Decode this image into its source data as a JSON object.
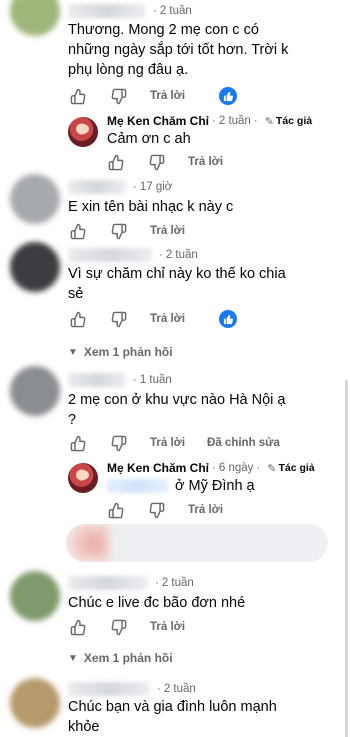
{
  "comments": [
    {
      "time": "2 tuần",
      "text_lines": [
        "Thương. Mong 2 mẹ con c có",
        "những ngày sắp tới tốt hơn. Trời k",
        "phụ lòng ng đâu ạ."
      ],
      "reply_label": "Trả lời",
      "reaction": "like",
      "avatar_color": "#9fb57a"
    },
    {
      "author": "Mẹ Ken Chăm Chỉ",
      "time": "2 tuần",
      "badge": "Tác giả",
      "text_lines": [
        "Cảm ơn c ah"
      ],
      "reply_label": "Trả lời"
    },
    {
      "time": "17 giờ",
      "text_lines": [
        "E xin tên bài nhạc k này c"
      ],
      "reply_label": "Trả lời",
      "avatar_color": "#a6a9ad"
    },
    {
      "time": "2 tuần",
      "text_lines": [
        "Vì sự chăm chỉ này ko thế ko chia",
        "sẻ"
      ],
      "reply_label": "Trả lời",
      "reaction": "like",
      "view_replies": "Xem 1 phản hồi",
      "avatar_color": "#3b3d40"
    },
    {
      "time": "1 tuần",
      "text_lines": [
        "2 mẹ con ở khu vực nào Hà Nội ạ",
        "?"
      ],
      "reply_label": "Trả lời",
      "edited": "Đã chỉnh sửa",
      "avatar_color": "#8a8d91"
    },
    {
      "author": "Mẹ Ken Chăm Chỉ",
      "time": "6 ngày",
      "badge": "Tác giả",
      "text_lines": [
        "ở Mỹ Đình ạ"
      ],
      "reply_label": "Trả lời"
    },
    {
      "time": "2 tuần",
      "text_lines": [
        "Chúc e live đc bão đơn nhé"
      ],
      "reply_label": "Trả lời",
      "view_replies": "Xem 1 phản hồi",
      "avatar_color": "#7f9a6a"
    },
    {
      "time": "2 tuần",
      "text_lines": [
        "Chúc bạn và gia đình luôn mạnh",
        "khỏe"
      ],
      "avatar_color": "#b59a6c"
    }
  ]
}
